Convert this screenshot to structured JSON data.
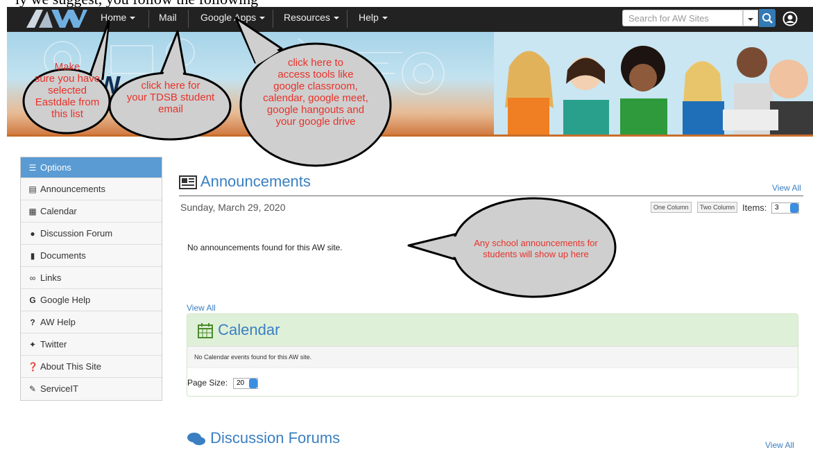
{
  "nav": {
    "home": "Home",
    "mail": "Mail",
    "google_apps": "Google Apps",
    "resources": "Resources",
    "help": "Help",
    "search_placeholder": "Search for AW Sites"
  },
  "sidebar": {
    "items": [
      {
        "label": "Options",
        "icon": "list-icon"
      },
      {
        "label": "Announcements",
        "icon": "newspaper-icon"
      },
      {
        "label": "Calendar",
        "icon": "calendar-icon"
      },
      {
        "label": "Discussion Forum",
        "icon": "comments-icon"
      },
      {
        "label": "Documents",
        "icon": "file-icon"
      },
      {
        "label": "Links",
        "icon": "link-icon"
      },
      {
        "label": "Google Help",
        "icon": "google-icon"
      },
      {
        "label": "AW Help",
        "icon": "question-icon"
      },
      {
        "label": "Twitter",
        "icon": "twitter-icon"
      },
      {
        "label": "About This Site",
        "icon": "question-circle-icon"
      },
      {
        "label": "ServiceIT",
        "icon": "wrench-icon"
      }
    ]
  },
  "announcements": {
    "title": "Announcements",
    "view_all": "View All",
    "date": "Sunday, March 29, 2020",
    "one_column": "One Column",
    "two_column": "Two Column",
    "items_label": "Items:",
    "items_value": "3",
    "empty": "No announcements found for this AW site.",
    "view_all_bottom": "View All"
  },
  "calendar": {
    "title": "Calendar",
    "empty": "No Calendar events found for this AW site.",
    "page_size_label": "Page Size:",
    "page_size_value": "20"
  },
  "discussion": {
    "title": "Discussion Forums",
    "view_all": "View All"
  },
  "callouts": {
    "home": [
      "Make",
      "sure you have",
      "selected",
      "Eastdale from",
      "this list"
    ],
    "mail": [
      "click here for",
      "your TDSB student",
      "email"
    ],
    "apps": [
      "click here to",
      "access tools like",
      "google classroom,",
      "calendar, google meet,",
      "google hangouts and",
      "your google drive"
    ],
    "announcements": [
      "Any school announcements for",
      "students will show up here"
    ]
  },
  "banner_partial_text": "W    oc",
  "colors": {
    "navbar": "#222222",
    "link": "#3a7fc1",
    "callout_text": "#e8322a",
    "calendar_head": "#dff0d8"
  }
}
